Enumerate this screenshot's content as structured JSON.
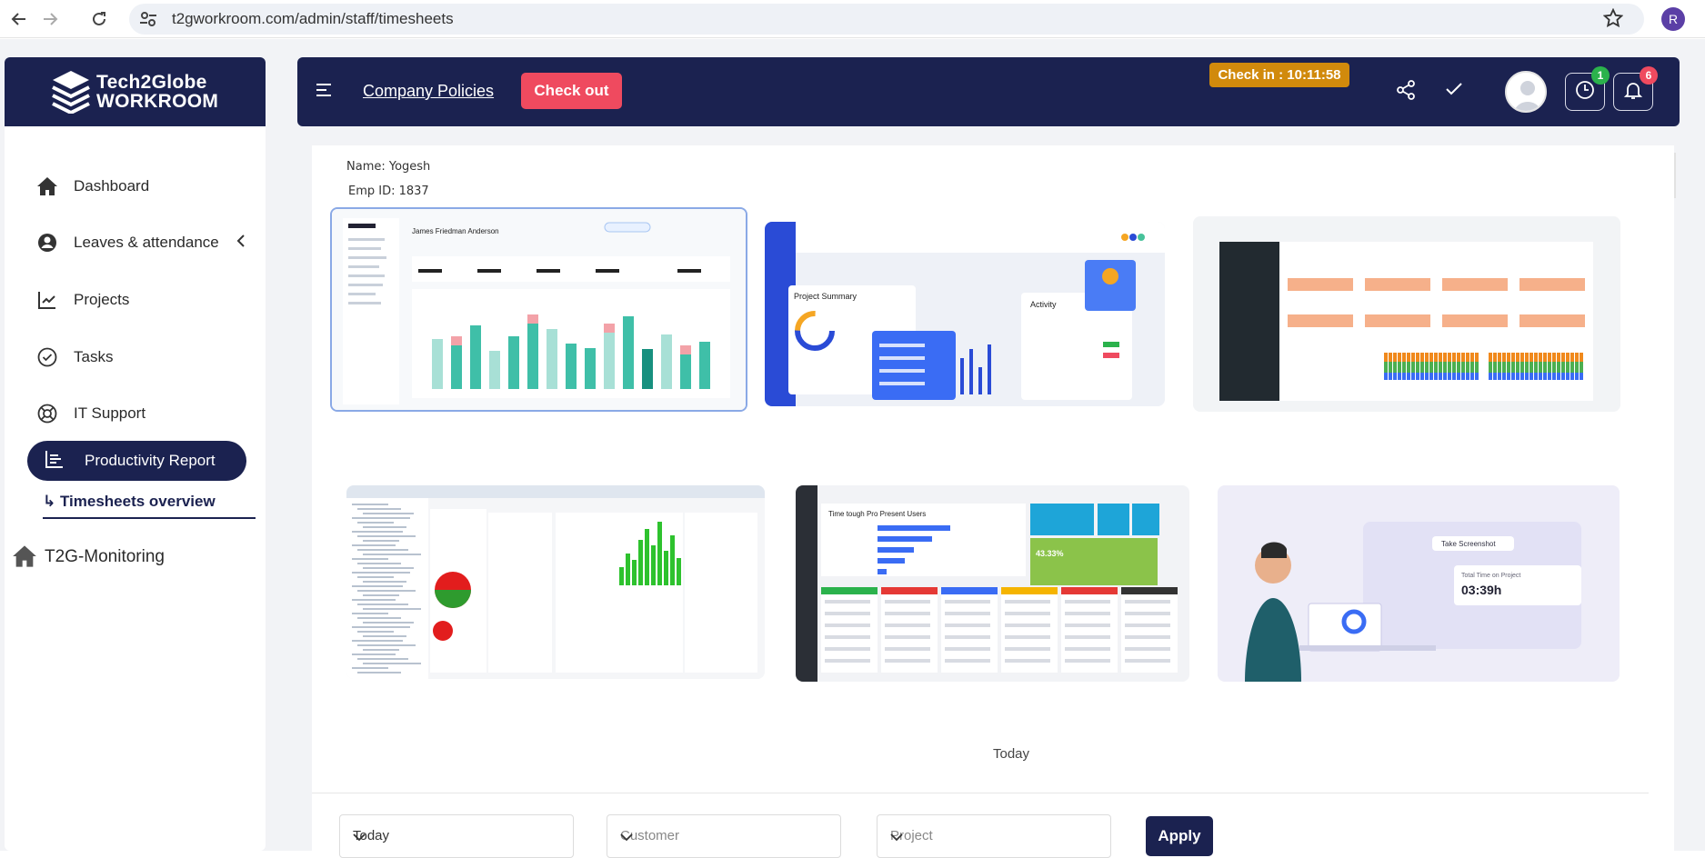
{
  "browser": {
    "url": "t2gworkroom.com/admin/staff/timesheets",
    "profile_initial": "R"
  },
  "brand": {
    "line1": "Tech2Globe",
    "line2": "WORKROOM"
  },
  "sidebar": {
    "items": [
      {
        "label": "Dashboard",
        "icon": "home-icon"
      },
      {
        "label": "Leaves & attendance",
        "icon": "user-circle-icon"
      },
      {
        "label": "Projects",
        "icon": "chart-icon"
      },
      {
        "label": "Tasks",
        "icon": "check-circle-icon"
      },
      {
        "label": "IT Support",
        "icon": "lifebuoy-icon"
      }
    ],
    "active": {
      "label": "Productivity Report",
      "icon": "report-icon"
    },
    "sub_item": "↳ Timesheets overview",
    "monitoring": "T2G-Monitoring"
  },
  "header": {
    "policies_link": "Company Policies",
    "checkout_label": "Check out",
    "checkin_text": "Check in : 10:11:58",
    "clock_badge": "1",
    "bell_badge": "6"
  },
  "employee": {
    "name": "Name: Yogesh",
    "emp_id": "Emp ID: 1837"
  },
  "screenshots": {
    "shot1_title": "James Friedman Anderson",
    "shot2_title": "Project Summary",
    "shot2_activity": "Activity",
    "shot5_title": "Time tough Pro Present Users",
    "shot5_percent": "43.33%",
    "shot6_take": "Take Screenshot",
    "shot6_total": "Total Time on Project",
    "shot6_time": "03:39h"
  },
  "filters": {
    "period_heading": "Today",
    "period_value": "Today",
    "customer_placeholder": "Customer",
    "project_placeholder": "Project",
    "apply_label": "Apply"
  },
  "colors": {
    "navy": "#1b2250",
    "checkout": "#ef4a5f",
    "checkin": "#d18a0c",
    "badge_green": "#2bb24c",
    "badge_red": "#ef4a5f"
  }
}
